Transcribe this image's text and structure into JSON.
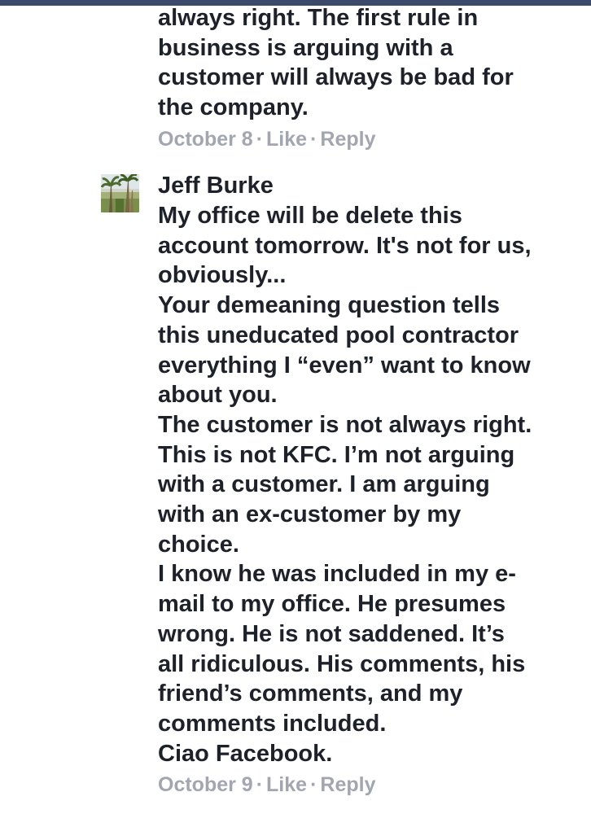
{
  "colors": {
    "text": "#1d2129",
    "meta": "#a2a6b0",
    "top_bar": "#3b4a6b"
  },
  "comments": [
    {
      "author": "",
      "lines": [
        "always right. The first rule in",
        "business is arguing with a",
        "customer will always be bad for",
        "the company."
      ],
      "meta": {
        "date": "October 8",
        "separator": "·",
        "like": "Like",
        "reply": "Reply"
      }
    },
    {
      "author": "Jeff Burke",
      "avatar_icon": "profile-photo-palm-trees",
      "lines": [
        "My office will be delete this",
        "account tomorrow.  It's not for us,",
        "obviously...",
        "Your demeaning question tells",
        "this uneducated pool contractor",
        "everything I “even” want to know",
        "about you.",
        "The customer is not always right.",
        "This is not KFC.  I’m not arguing",
        "with a customer.  I am arguing",
        "with an ex-customer by my",
        "choice.",
        "I know he was included in my e-",
        "mail to my office.  He presumes",
        "wrong.  He is not saddened.  It’s",
        "all ridiculous.  His comments, his",
        "friend’s comments, and my",
        "comments included.",
        "Ciao Facebook."
      ],
      "meta": {
        "date": "October 9",
        "separator": "·",
        "like": "Like",
        "reply": "Reply"
      }
    }
  ]
}
